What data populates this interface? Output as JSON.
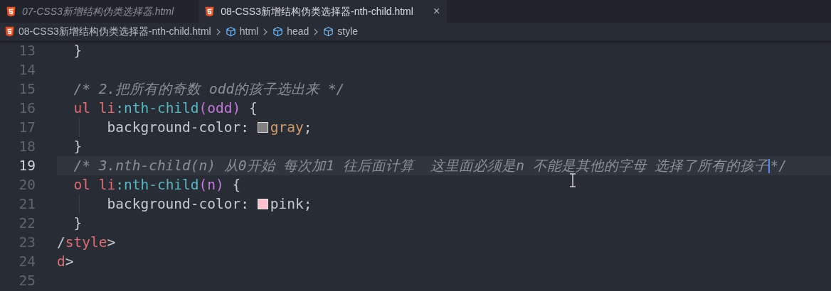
{
  "tabs": [
    {
      "label": "07-CSS3新增结构伪类选择器.html",
      "selected": false,
      "preview": true
    },
    {
      "label": "08-CSS3新增结构伪类选择器-nth-child.html",
      "selected": true,
      "preview": false,
      "close": "×"
    }
  ],
  "breadcrumb": [
    {
      "kind": "file",
      "label": "08-CSS3新增结构伪类选择器-nth-child.html"
    },
    {
      "kind": "symbol",
      "label": "html"
    },
    {
      "kind": "symbol",
      "label": "head"
    },
    {
      "kind": "symbol",
      "label": "style"
    }
  ],
  "editor": {
    "lines": [
      {
        "number": "13",
        "current": false,
        "tokens": [
          {
            "kind": "text",
            "text": "  }"
          }
        ]
      },
      {
        "number": "14",
        "current": false
      },
      {
        "number": "15",
        "current": false,
        "tokens": [
          {
            "kind": "comment",
            "text": "  /* 2.把所有的奇数 odd的孩子选出来 */"
          }
        ]
      },
      {
        "number": "16",
        "current": false,
        "tokens": [
          {
            "kind": "tag",
            "text": "  ul li"
          },
          {
            "kind": "pseudo",
            "text": ":nth-child"
          },
          {
            "kind": "paren",
            "text": "(odd)"
          },
          {
            "kind": "text",
            "text": " {"
          }
        ]
      },
      {
        "number": "17",
        "current": false,
        "guide": true,
        "tokens": [
          {
            "kind": "text",
            "text": "      background-color: "
          },
          {
            "kind": "swatch",
            "color": "#808080"
          },
          {
            "kind": "value",
            "text": "gray"
          },
          {
            "kind": "text",
            "text": ";"
          }
        ]
      },
      {
        "number": "18",
        "current": false,
        "tokens": [
          {
            "kind": "text",
            "text": "  }"
          }
        ]
      },
      {
        "number": "19",
        "current": true,
        "tokens": [
          {
            "kind": "comment",
            "text": "  /* 3.nth-child(n) 从0开始 每次加1 往后面计算  这里面必须是n 不能是其他的字母 选择了所有的孩子"
          },
          {
            "kind": "cursor"
          },
          {
            "kind": "comment",
            "text": "*/"
          }
        ]
      },
      {
        "number": "20",
        "current": false,
        "tokens": [
          {
            "kind": "tag",
            "text": "  ol li"
          },
          {
            "kind": "pseudo",
            "text": ":nth-child"
          },
          {
            "kind": "paren",
            "text": "(n)"
          },
          {
            "kind": "text",
            "text": " {"
          }
        ]
      },
      {
        "number": "21",
        "current": false,
        "guide": true,
        "tokens": [
          {
            "kind": "text",
            "text": "      background-color: "
          },
          {
            "kind": "swatch",
            "color": "#ffc0cb"
          },
          {
            "kind": "text",
            "text": "pink;"
          }
        ]
      },
      {
        "number": "22",
        "current": false,
        "tokens": [
          {
            "kind": "text",
            "text": "  }"
          }
        ]
      },
      {
        "number": "23",
        "current": false,
        "tokens": [
          {
            "kind": "text",
            "text": "/"
          },
          {
            "kind": "tag",
            "text": "style"
          },
          {
            "kind": "text",
            "text": ">"
          }
        ]
      },
      {
        "number": "24",
        "current": false,
        "tokens": [
          {
            "kind": "tag",
            "text": "d"
          },
          {
            "kind": "text",
            "text": ">"
          }
        ]
      },
      {
        "number": "25",
        "current": false
      }
    ]
  }
}
